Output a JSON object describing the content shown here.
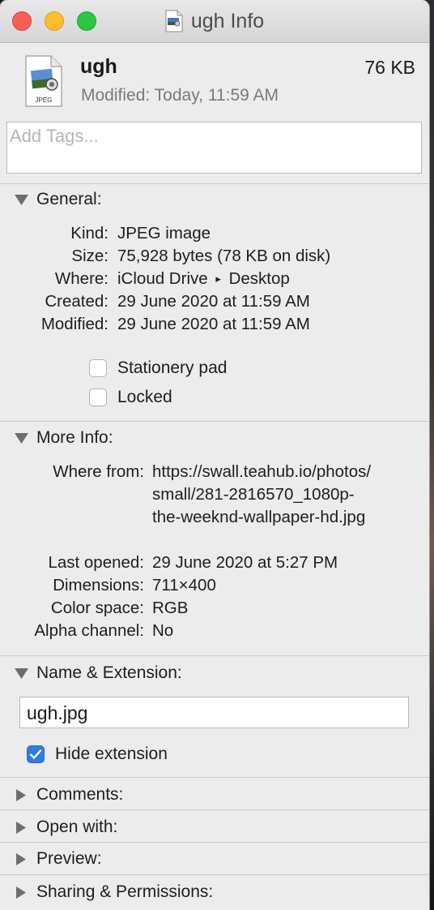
{
  "window": {
    "title": "ugh Info"
  },
  "file": {
    "name": "ugh",
    "size": "76 KB",
    "modified_line": "Modified: Today, 11:59 AM",
    "icon_label": "JPEG"
  },
  "tags": {
    "placeholder": "Add Tags..."
  },
  "general": {
    "header": "General:",
    "rows": [
      {
        "label": "Kind:",
        "value": "JPEG image"
      },
      {
        "label": "Size:",
        "value": "75,928 bytes (78 KB on disk)"
      },
      {
        "label": "Where:",
        "value_part1": "iCloud Drive",
        "value_separator": "▸",
        "value_part2": "Desktop"
      },
      {
        "label": "Created:",
        "value": "29 June 2020 at 11:59 AM"
      },
      {
        "label": "Modified:",
        "value": "29 June 2020 at 11:59 AM"
      }
    ],
    "stationery_label": "Stationery pad",
    "locked_label": "Locked"
  },
  "more_info": {
    "header": "More Info:",
    "where_from_label": "Where from:",
    "where_from_lines": [
      "https://swall.teahub.io/photos/",
      "small/281-2816570_1080p-",
      "the-weeknd-wallpaper-hd.jpg"
    ],
    "rows": [
      {
        "label": "Last opened:",
        "value": "29 June 2020 at 5:27 PM"
      },
      {
        "label": "Dimensions:",
        "value": "711×400"
      },
      {
        "label": "Color space:",
        "value": "RGB"
      },
      {
        "label": "Alpha channel:",
        "value": "No"
      }
    ]
  },
  "name_extension": {
    "header": "Name & Extension:",
    "value": "ugh.jpg",
    "hide_extension_label": "Hide extension",
    "hide_extension_checked": true
  },
  "collapsed_sections": [
    {
      "label": "Comments:"
    },
    {
      "label": "Open with:"
    },
    {
      "label": "Preview:"
    },
    {
      "label": "Sharing & Permissions:"
    }
  ],
  "colors": {
    "accent": "#2f7ae5",
    "close": "#fd5d57",
    "minimize": "#febc2e",
    "zoom": "#28c840"
  }
}
